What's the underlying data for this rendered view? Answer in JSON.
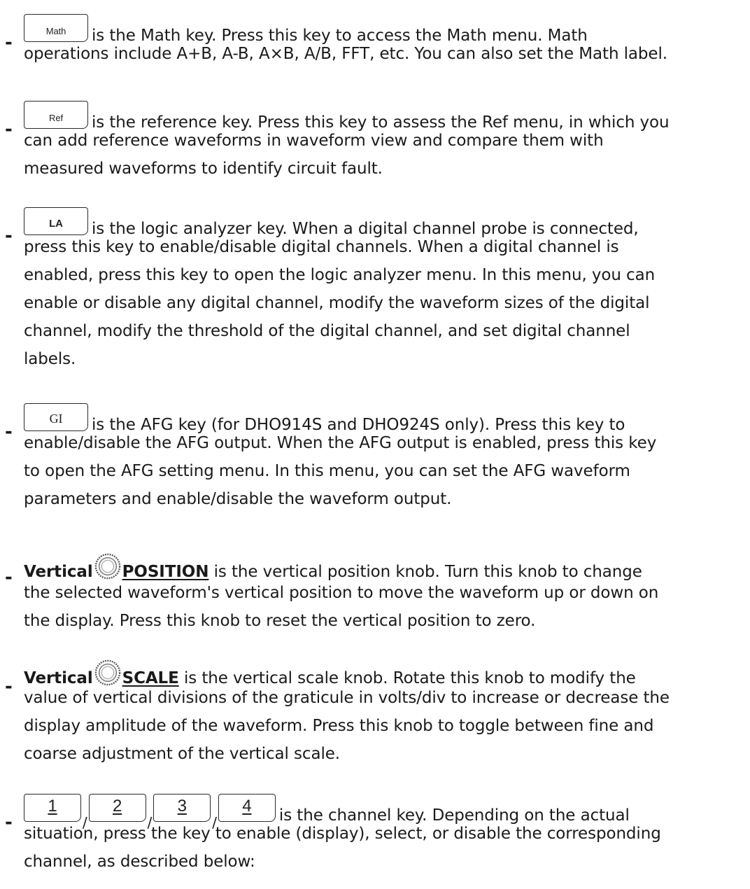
{
  "items": [
    {
      "key_label": "Math",
      "lines": [
        "is the Math key. Press this key to access the Math menu. Math",
        "operations include A+B, A-B, A×B, A/B, FFT, etc. You can also set the Math label."
      ]
    },
    {
      "key_label": "Ref",
      "lines": [
        "is the reference key. Press this key to assess the Ref menu, in which you",
        "can add reference waveforms in waveform view and compare them with",
        "measured waveforms to identify circuit fault."
      ]
    },
    {
      "key_label": "LA",
      "lines": [
        "is the logic analyzer key. When a digital channel probe is connected,",
        "press this key to enable/disable digital channels. When a digital channel is",
        "enabled, press this key to open the logic analyzer menu. In this menu, you can",
        "enable or disable any digital channel, modify the waveform sizes of the digital",
        "channel, modify the threshold of the digital channel, and set digital channel",
        "labels."
      ]
    },
    {
      "key_label": "GI",
      "lines": [
        "is the AFG key (for DHO914S and DHO924S only). Press this key to",
        "enable/disable the AFG output. When the AFG output is enabled, press this key",
        "to open the AFG setting menu. In this menu, you can set the AFG waveform",
        "parameters and enable/disable the waveform output."
      ]
    },
    {
      "prefix": "Vertical",
      "knob_icon": "rotary-knob-icon",
      "knob_name": "POSITION",
      "lines": [
        "is the vertical position knob. Turn this knob to change",
        "the selected waveform's vertical position to move the waveform up or down on",
        "the display. Press this knob to reset the vertical position to zero."
      ]
    },
    {
      "prefix": "Vertical",
      "knob_icon": "rotary-knob-icon",
      "knob_name": "SCALE",
      "lines": [
        "is the vertical scale knob. Rotate this knob to modify the",
        "value of vertical divisions of the graticule in volts/div to increase or decrease the",
        "display amplitude of the waveform. Press this knob to toggle between fine and",
        "coarse adjustment of the vertical scale."
      ]
    },
    {
      "channel_keys": [
        "1",
        "2",
        "3",
        "4"
      ],
      "separator": "/",
      "lines": [
        "is the channel key. Depending on the actual",
        "situation, press the key to enable (display), select, or disable the corresponding",
        "channel, as described below:"
      ]
    }
  ],
  "bullet": "-"
}
